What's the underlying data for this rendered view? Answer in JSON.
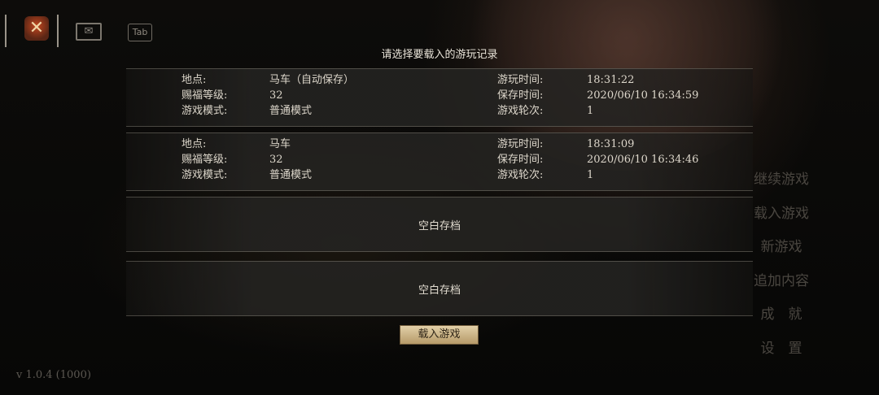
{
  "top_icons": {
    "bell": "bell-crossed-icon",
    "letter": "letter-icon",
    "tab_label": "Tab"
  },
  "dialog": {
    "title": "请选择要载入的游玩记录",
    "saves": [
      {
        "location_label": "地点:",
        "location": "马车（自动保存）",
        "level_label": "赐福等级:",
        "level": "32",
        "mode_label": "游戏模式:",
        "mode": "普通模式",
        "playtime_label": "游玩时间:",
        "playtime": "18:31:22",
        "savetime_label": "保存时间:",
        "savetime": "2020/06/10 16:34:59",
        "round_label": "游戏轮次:",
        "round": "1"
      },
      {
        "location_label": "地点:",
        "location": "马车",
        "level_label": "赐福等级:",
        "level": "32",
        "mode_label": "游戏模式:",
        "mode": "普通模式",
        "playtime_label": "游玩时间:",
        "playtime": "18:31:09",
        "savetime_label": "保存时间:",
        "savetime": "2020/06/10 16:34:46",
        "round_label": "游戏轮次:",
        "round": "1"
      }
    ],
    "empty_slots": [
      "空白存档",
      "空白存档"
    ],
    "load_button": "载入游戏"
  },
  "main_menu": [
    "继续游戏",
    "载入游戏",
    "新游戏",
    "追加内容",
    "成　就",
    "设　置"
  ],
  "version": "v 1.0.4 (1000)",
  "colors": {
    "button_top": "#e2d0a8",
    "button_bottom": "#b69a69",
    "menu_text": "#4a4640",
    "accent_icon": "#c2461f"
  }
}
